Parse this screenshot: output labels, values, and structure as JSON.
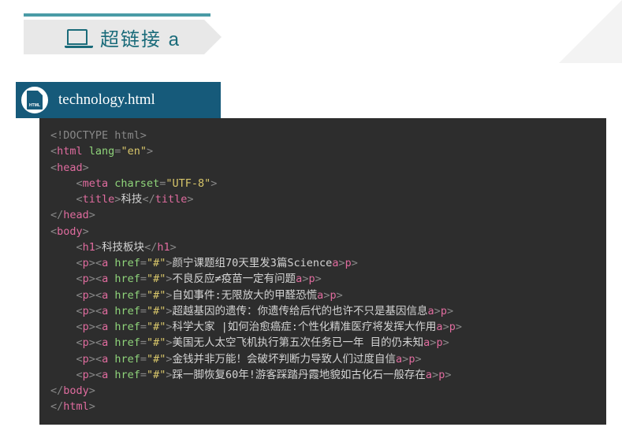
{
  "header": {
    "title": "超链接 a",
    "icon_name": "laptop-icon"
  },
  "file": {
    "name": "technology.html",
    "icon_name": "html-file-icon",
    "icon_label": "HTML"
  },
  "code": {
    "line1": {
      "doctype": "<!DOCTYPE html>"
    },
    "line2": {
      "open": "<",
      "tag": "html",
      "attr": " lang",
      "eq": "=",
      "val": "\"en\"",
      "close": ">"
    },
    "line3": {
      "open": "<",
      "tag": "head",
      "close": ">"
    },
    "line4": {
      "indent": "    ",
      "open": "<",
      "tag": "meta",
      "attr": " charset",
      "eq": "=",
      "val": "\"UTF-8\"",
      "close": ">"
    },
    "line5": {
      "indent": "    ",
      "open1": "<",
      "tag1": "title",
      "close1": ">",
      "text": "科技",
      "open2": "</",
      "tag2": "title",
      "close2": ">"
    },
    "line6": {
      "open": "</",
      "tag": "head",
      "close": ">"
    },
    "line7": {
      "open": "<",
      "tag": "body",
      "close": ">"
    },
    "line8": {
      "indent": "    ",
      "open1": "<",
      "tag1": "h1",
      "close1": ">",
      "text": "科技板块",
      "open2": "</",
      "tag2": "h1",
      "close2": ">"
    },
    "links": [
      {
        "text": "颜宁课题组70天里发3篇Science"
      },
      {
        "text": "不良反应≠疫苗一定有问题"
      },
      {
        "text": "自如事件:无限放大的甲醛恐慌"
      },
      {
        "text": "超越基因的遗传：你遗传给后代的也许不只是基因信息"
      },
      {
        "text": "科学大家 |如何治愈癌症:个性化精准医疗将发挥大作用"
      },
      {
        "text": "美国无人太空飞机执行第五次任务已一年 目的仍未知"
      },
      {
        "text": "金钱并非万能！会破坏判断力导致人们过度自信"
      },
      {
        "text": "踩一脚恢复60年!游客踩踏丹霞地貌如古化石一般存在"
      }
    ],
    "link_common": {
      "indent": "    ",
      "p_open": "<",
      "p_tag": "p",
      "p_close": ">",
      "a_open": "<",
      "a_tag": "a",
      "a_attr": " href",
      "a_eq": "=",
      "a_val": "\"#\"",
      "a_close": ">",
      "a_end_open": "</",
      "a_end_close": ">",
      "p_end_open": "</",
      "p_end_close": ">"
    },
    "line_body_end": {
      "open": "</",
      "tag": "body",
      "close": ">"
    },
    "line_html_end": {
      "open": "</",
      "tag": "html",
      "close": ">"
    }
  }
}
